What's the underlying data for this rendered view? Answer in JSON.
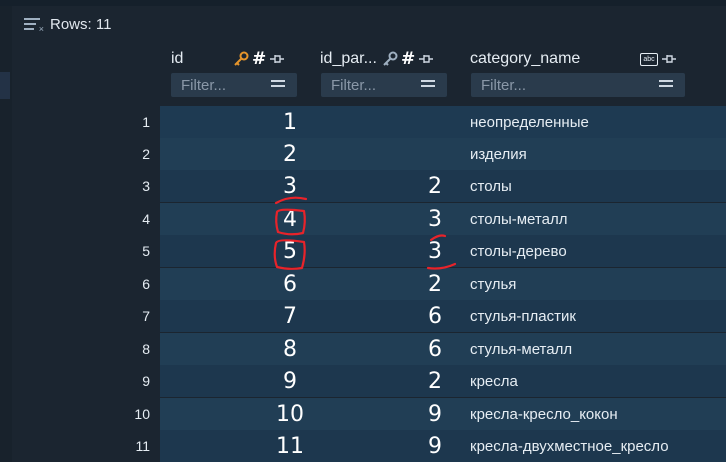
{
  "toolbar": {
    "rows_label": "Rows: 11"
  },
  "columns": {
    "id": {
      "label": "id",
      "filter_placeholder": "Filter..."
    },
    "id_parent": {
      "label": "id_par...",
      "filter_placeholder": "Filter..."
    },
    "category_name": {
      "label": "category_name",
      "filter_placeholder": "Filter..."
    }
  },
  "rows": [
    {
      "num": "1",
      "id": "1",
      "id_parent": "",
      "category_name": "неопределенные"
    },
    {
      "num": "2",
      "id": "2",
      "id_parent": "",
      "category_name": "изделия"
    },
    {
      "num": "3",
      "id": "3",
      "id_parent": "2",
      "category_name": "столы"
    },
    {
      "num": "4",
      "id": "4",
      "id_parent": "3",
      "category_name": "столы-металл"
    },
    {
      "num": "5",
      "id": "5",
      "id_parent": "3",
      "category_name": "столы-дерево"
    },
    {
      "num": "6",
      "id": "6",
      "id_parent": "2",
      "category_name": "стулья"
    },
    {
      "num": "7",
      "id": "7",
      "id_parent": "6",
      "category_name": "стулья-пластик"
    },
    {
      "num": "8",
      "id": "8",
      "id_parent": "6",
      "category_name": "стулья-металл"
    },
    {
      "num": "9",
      "id": "9",
      "id_parent": "2",
      "category_name": "кресла"
    },
    {
      "num": "10",
      "id": "10",
      "id_parent": "9",
      "category_name": "кресла-кресло_кокон"
    },
    {
      "num": "11",
      "id": "11",
      "id_parent": "9",
      "category_name": "кресла-двухместное_кресло"
    }
  ],
  "colors": {
    "annotation": "#e8232a",
    "key_icon": "#e6952b",
    "row_bg": "#1e3a52"
  }
}
